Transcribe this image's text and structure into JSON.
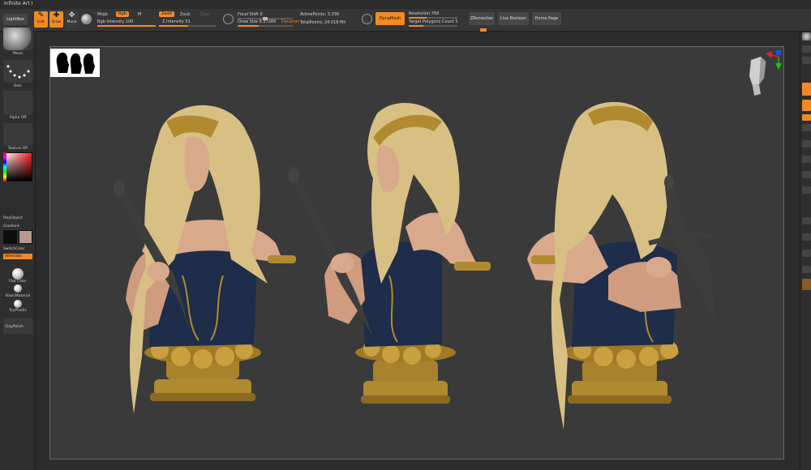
{
  "window": {
    "title": "Infinite Art I"
  },
  "toolbar": {
    "lightbox_label": "LightBox",
    "edit_label": "Edit",
    "draw_label": "Draw",
    "move_label": "Move",
    "mrgb_label": "Mrgb",
    "rgb_label": "Rgb",
    "m_label": "M",
    "rgb_intensity": "Rgb Intensity 100",
    "zadd_label": "Zadd",
    "zsub_label": "Zsub",
    "zcut_label": "Zcut",
    "z_intensity": "Z Intensity 51",
    "focal_shift": "Focal Shift 0",
    "draw_size": "Draw Size 9.37289",
    "dynamic_label": "Dynamic",
    "active_points": "ActivePoints: 3.339",
    "total_points": "TotalPoints: 24.018 Mil",
    "dynamesh_label": "DynaMesh",
    "resolution": "Resolution 768",
    "target_polygons": "Target Polygons Count 5",
    "zremesher_label": "ZRemesher",
    "live_boolean_label": "Live Boolean",
    "home_page_label": "Home Page"
  },
  "left_shelf": {
    "brush_label": "Move",
    "stroke_label": "Dots",
    "alpha_label": "Alpha Off",
    "texture_label": "Texture Off",
    "material_label": "SkinShade4",
    "polyobject_label": "PolyObject",
    "gradient_label": "Gradient",
    "switchcolor_label": "SwitchColor",
    "alternate_label": "Alternate",
    "flat_color_label": "Flat Color",
    "basic_material_label": "BasicMaterial",
    "toy_plastic_label": "ToyPlastic",
    "clay_polish_label": "ClayPolish"
  },
  "colors": {
    "accent": "#f08a25",
    "panel": "#353535",
    "canvas": "#3a3a3a",
    "hair": "#d8bf83",
    "dress": "#1d2d4a",
    "gold": "#b08a2e",
    "skin": "#d9a98c"
  },
  "icons": [
    "edit-icon",
    "draw-icon",
    "move-icon",
    "sphere-icon",
    "gizmo-head-icon",
    "silhouette-icon"
  ]
}
